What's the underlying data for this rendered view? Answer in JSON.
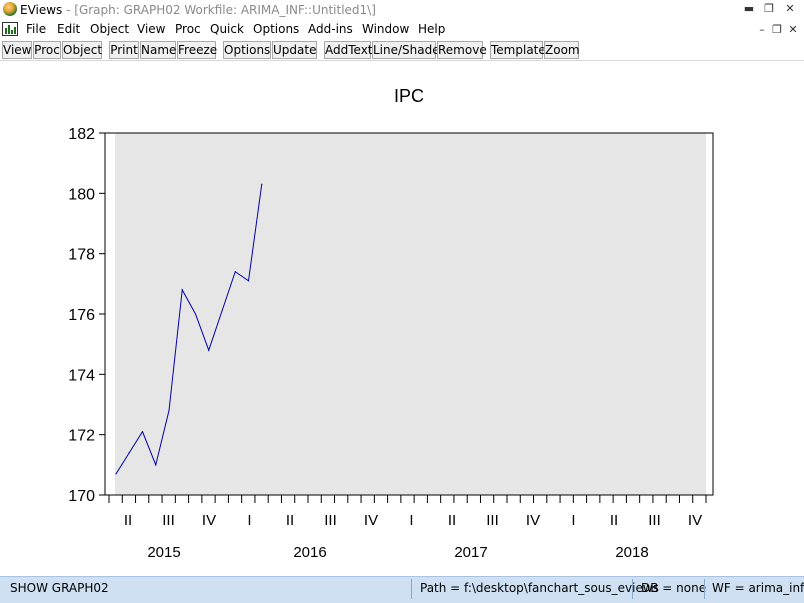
{
  "window": {
    "app_name": "EViews",
    "doc_title": " - [Graph: GRAPH02   Workfile: ARIMA_INF::Untitled1\\]",
    "controls": {
      "minimize": "▬",
      "restore": "❐",
      "close": "✕"
    }
  },
  "menu": {
    "items": [
      "File",
      "Edit",
      "Object",
      "View",
      "Proc",
      "Quick",
      "Options",
      "Add-ins",
      "Window",
      "Help"
    ],
    "mdi_controls": {
      "minimize": "–",
      "restore": "❐",
      "close": "✕"
    }
  },
  "toolbar": {
    "buttons": [
      "View",
      "Proc",
      "Object",
      "Print",
      "Name",
      "Freeze",
      "Options",
      "Update",
      "AddText",
      "Line/Shade",
      "Remove",
      "Template",
      "Zoom"
    ]
  },
  "chart_data": {
    "type": "line",
    "title": "IPC",
    "xlabel": "",
    "ylabel": "",
    "ylim": [
      170,
      182
    ],
    "yticks": [
      170,
      172,
      174,
      176,
      178,
      180,
      182
    ],
    "x_quarter_labels": [
      "II",
      "III",
      "IV",
      "I",
      "II",
      "III",
      "IV",
      "I",
      "II",
      "III",
      "IV",
      "I",
      "II",
      "III",
      "IV"
    ],
    "x_year_labels": [
      "2015",
      "2016",
      "2017",
      "2018"
    ],
    "series_color": "#0000aa",
    "plot_background": "#e6e6e6",
    "series": [
      {
        "name": "",
        "x": [
          "2015M04",
          "2015M05",
          "2015M06",
          "2015M07",
          "2015M08",
          "2015M09",
          "2015M10",
          "2015M11",
          "2015M12",
          "2016M01",
          "2016M02",
          "2016M03",
          "2016M04"
        ],
        "values": [
          170.7,
          171.4,
          172.1,
          171.0,
          172.8,
          176.8,
          176.0,
          174.8,
          176.1,
          177.4,
          177.1,
          180.3,
          null
        ]
      }
    ]
  },
  "statusbar": {
    "left": "SHOW GRAPH02",
    "path": "Path = f:\\desktop\\fanchart_sous_eviews",
    "db": "DB = none",
    "wf": "WF = arima_inf"
  }
}
